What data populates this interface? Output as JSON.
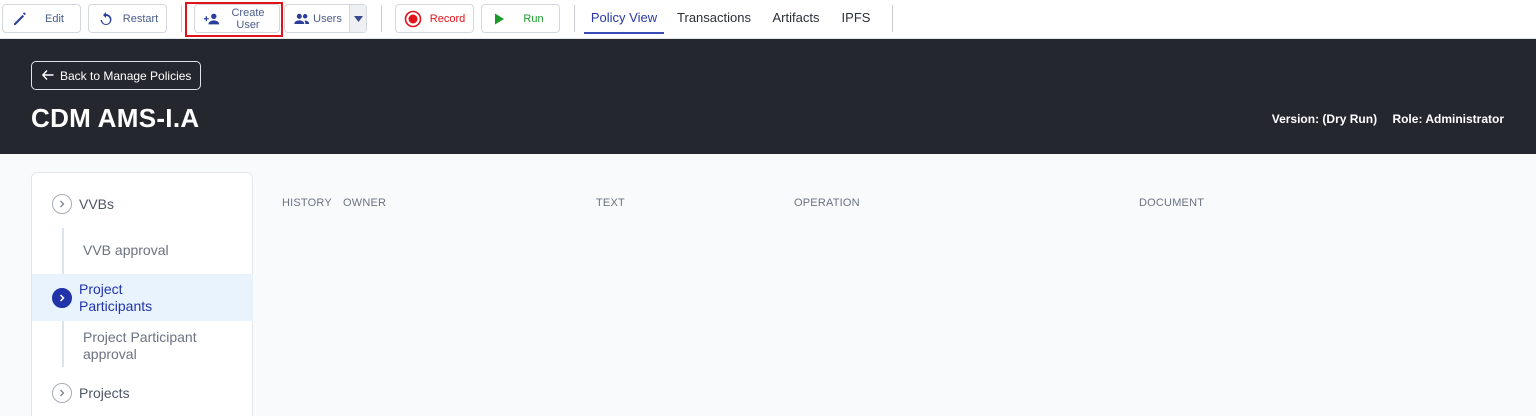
{
  "toolbar": {
    "edit_label": "Edit",
    "restart_label": "Restart",
    "create_user_label": "Create User",
    "users_label": "Users",
    "record_label": "Record",
    "run_label": "Run",
    "tabs": [
      {
        "label": "Policy View",
        "active": true
      },
      {
        "label": "Transactions",
        "active": false
      },
      {
        "label": "Artifacts",
        "active": false
      },
      {
        "label": "IPFS",
        "active": false
      }
    ]
  },
  "header": {
    "back_label": "Back to Manage Policies",
    "title": "CDM AMS-I.A",
    "version": "Version: (Dry Run)",
    "role": "Role: Administrator"
  },
  "sidebar": {
    "items": [
      {
        "label": "VVBs"
      },
      {
        "label": "VVB approval"
      },
      {
        "label": "Project Participants"
      },
      {
        "label": "Project Participant approval"
      },
      {
        "label": "Projects"
      }
    ]
  },
  "table": {
    "columns": [
      "HISTORY",
      "OWNER",
      "TEXT",
      "OPERATION",
      "DOCUMENT"
    ]
  },
  "colors": {
    "header_bg": "#25272e",
    "accent": "#2233aa",
    "record": "#e0131b",
    "run": "#1a9a2a",
    "highlight": "#e0131b"
  }
}
